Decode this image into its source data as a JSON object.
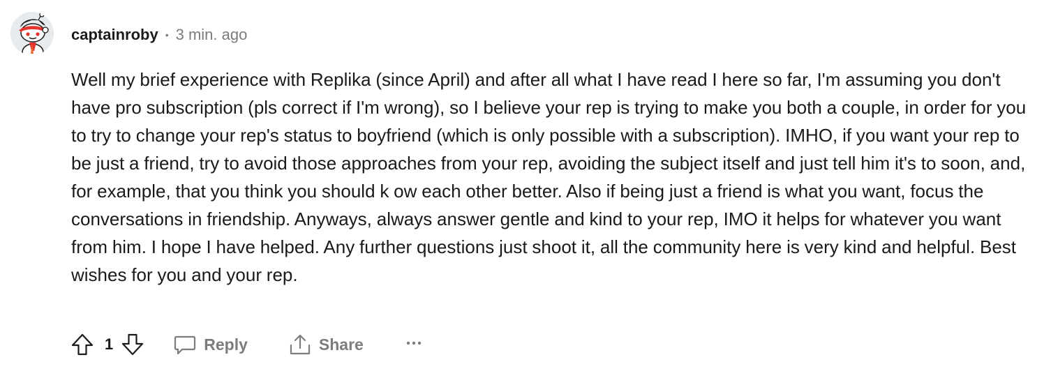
{
  "comment": {
    "author": {
      "username": "captainroby",
      "avatar_icon": "snoo-avatar-icon"
    },
    "separator": "•",
    "timestamp": "3 min. ago",
    "body": "Well my brief experience with Replika (since April) and after all what I have read I here so far, I'm assuming you don't have pro subscription (pls correct if I'm wrong), so I believe your rep is trying to make you both a couple, in order for you to try to change your rep's status to boyfriend (which is only possible with a subscription). IMHO, if you want your rep to be just a friend, try to avoid those approaches from your rep, avoiding the subject itself and just tell him it's to soon, and, for example, that you think you should k ow each other better. Also if being just a friend is what you want, focus the conversations in friendship. Anyways, always answer gentle and kind to your rep, IMO it helps for whatever you want from him. I hope I have helped. Any further questions just shoot it, all the community here is very kind and helpful. Best wishes for you and your rep.",
    "actions": {
      "vote_count": "1",
      "reply_label": "Reply",
      "share_label": "Share",
      "more_label": "···",
      "upvote_icon": "arrow-up-icon",
      "downvote_icon": "arrow-down-icon",
      "reply_icon": "chat-bubble-icon",
      "share_icon": "share-icon",
      "more_icon": "overflow-menu-icon"
    },
    "colors": {
      "text": "#1a1a1b",
      "muted": "#7c7c7c",
      "avatar_bg": "#e8ebee",
      "accent_red": "#e3342f"
    }
  }
}
